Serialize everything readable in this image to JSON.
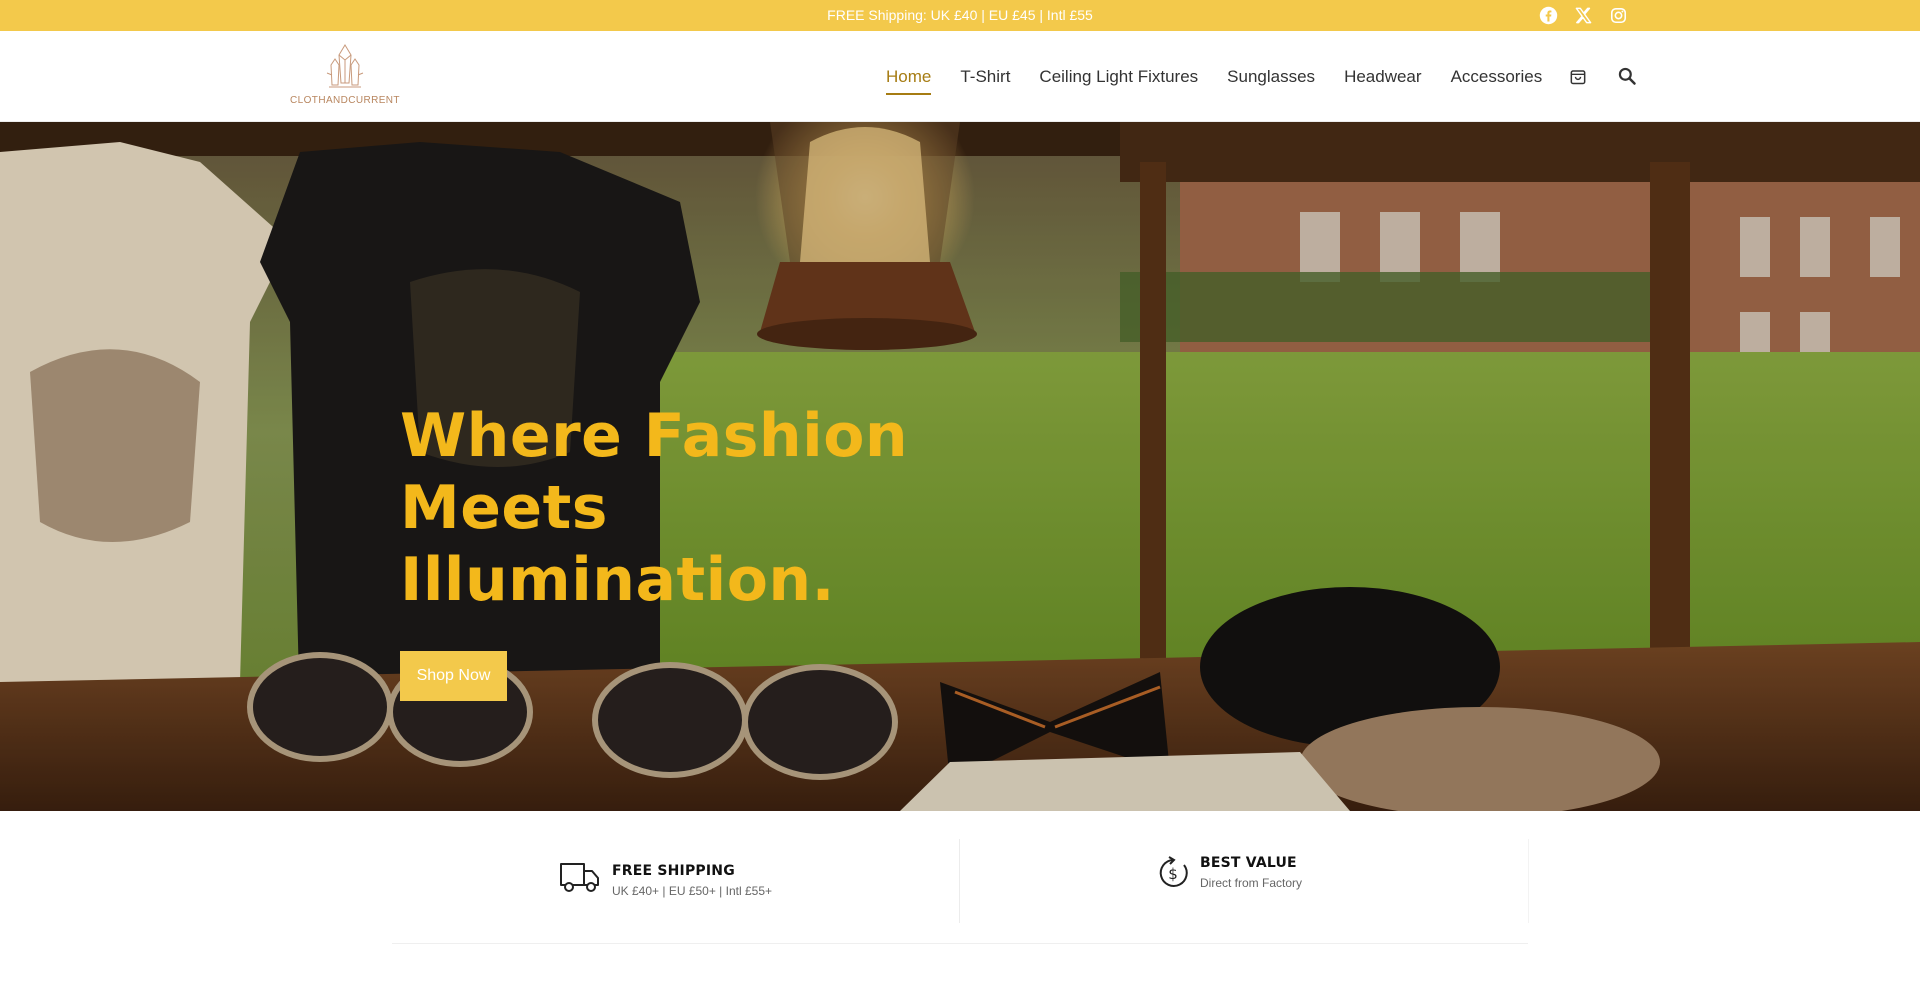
{
  "topbar": {
    "shipping_text": "FREE Shipping: UK  £40 | EU  £45 | Intl  £55",
    "background_color": "#f3c94b",
    "social_icons": [
      "facebook-icon",
      "x-twitter-icon",
      "instagram-icon"
    ]
  },
  "header": {
    "logo_text": "CLOTHANDCURRENT",
    "nav": [
      {
        "label": "Home",
        "active": true
      },
      {
        "label": "T-Shirt"
      },
      {
        "label": "Ceiling Light Fixtures"
      },
      {
        "label": "Sunglasses"
      },
      {
        "label": "Headwear"
      },
      {
        "label": "Accessories"
      }
    ],
    "icons": [
      "shopping-bag-icon",
      "search-icon"
    ],
    "active_color": "#a67c13"
  },
  "hero": {
    "title_lines": [
      "Where Fashion",
      "Meets",
      "Illumination."
    ],
    "button_label": "Shop Now",
    "title_color": "#f3b81b",
    "button_color": "#f3c94b"
  },
  "features": [
    {
      "icon": "delivery-truck-icon",
      "title": "FREE SHIPPING",
      "subtitle": "UK £40+ | EU £50+ | Intl £55+"
    },
    {
      "icon": "dollar-cycle-icon",
      "title": "BEST VALUE",
      "subtitle": "Direct from Factory"
    }
  ]
}
